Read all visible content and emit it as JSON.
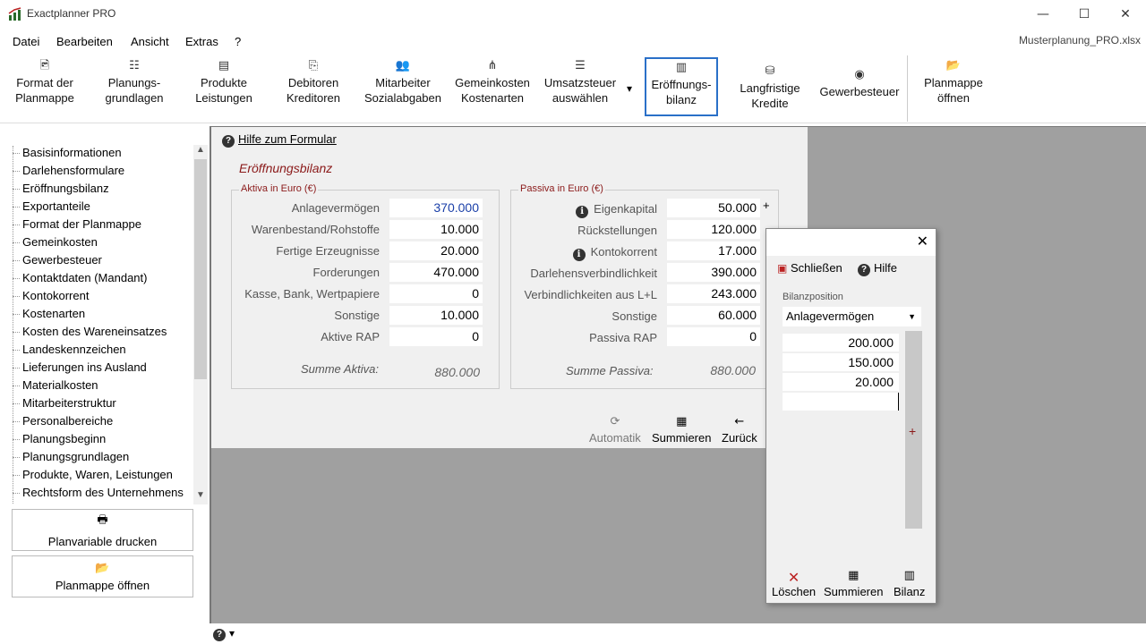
{
  "window": {
    "title": "Exactplanner PRO",
    "filename": "Musterplanung_PRO.xlsx",
    "minimize": "—",
    "maximize": "☐",
    "close": "✕"
  },
  "menu": {
    "items": [
      "Datei",
      "Bearbeiten",
      "Ansicht",
      "Extras",
      "?"
    ]
  },
  "ribbon": {
    "buttons": [
      {
        "label1": "Format der",
        "label2": "Planmappe",
        "icon": "🖻"
      },
      {
        "label1": "Planungs-",
        "label2": "grundlagen",
        "icon": "☷"
      },
      {
        "label1": "Produkte",
        "label2": "Leistungen",
        "icon": "▤"
      },
      {
        "label1": "Debitoren",
        "label2": "Kreditoren",
        "icon": "⎘"
      },
      {
        "label1": "Mitarbeiter",
        "label2": "Sozialabgaben",
        "icon": "👥"
      },
      {
        "label1": "Gemeinkosten",
        "label2": "Kostenarten",
        "icon": "⋔"
      },
      {
        "label1": "Umsatzsteuer",
        "label2": "auswählen",
        "icon": "☰"
      },
      {
        "label1": "Eröffnungs-",
        "label2": "bilanz",
        "icon": "▥"
      },
      {
        "label1": "Langfristige",
        "label2": "Kredite",
        "icon": "⛁"
      },
      {
        "label1": "Gewerbesteuer",
        "label2": "",
        "icon": "◉"
      },
      {
        "label1": "Planmappe",
        "label2": "öffnen",
        "icon": "📂"
      }
    ],
    "dropdown_icon": "▾"
  },
  "sidebar": {
    "items": [
      "Basisinformationen",
      "Darlehensformulare",
      "Eröffnungsbilanz",
      "Exportanteile",
      "Format der Planmappe",
      "Gemeinkosten",
      "Gewerbesteuer",
      "Kontaktdaten (Mandant)",
      "Kontokorrent",
      "Kostenarten",
      "Kosten des Wareneinsatzes",
      "Landeskennzeichen",
      "Lieferungen ins Ausland",
      "Materialkosten",
      "Mitarbeiterstruktur",
      "Personalbereiche",
      "Planungsbeginn",
      "Planungsgrundlagen",
      "Produkte, Waren, Leistungen",
      "Rechtsform des Unternehmens"
    ],
    "print_button": "Planvariable drucken",
    "open_button": "Planmappe öffnen",
    "print_icon": "🖶",
    "open_icon": "📂"
  },
  "form": {
    "help": "Hilfe zum Formular",
    "title": "Eröffnungsbilanz",
    "aktiva": {
      "legend": "Aktiva  in Euro (€)",
      "rows": [
        {
          "label": "Anlagevermögen",
          "value": "370.000"
        },
        {
          "label": "Warenbestand/Rohstoffe",
          "value": "10.000"
        },
        {
          "label": "Fertige Erzeugnisse",
          "value": "20.000"
        },
        {
          "label": "Forderungen",
          "value": "470.000"
        },
        {
          "label": "Kasse, Bank, Wertpapiere",
          "value": "0"
        },
        {
          "label": "Sonstige",
          "value": "10.000"
        },
        {
          "label": "Aktive RAP",
          "value": "0"
        }
      ],
      "sum_label": "Summe Aktiva:",
      "sum_value": "880.000"
    },
    "passiva": {
      "legend": "Passiva  in Euro (€)",
      "rows": [
        {
          "label": "Eigenkapital",
          "value": "50.000"
        },
        {
          "label": "Rückstellungen",
          "value": "120.000"
        },
        {
          "label": "Kontokorrent",
          "value": "17.000"
        },
        {
          "label": "Darlehensverbindlichkeit",
          "value": "390.000"
        },
        {
          "label": "Verbindlichkeiten aus L+L",
          "value": "243.000"
        },
        {
          "label": "Sonstige",
          "value": "60.000"
        },
        {
          "label": "Passiva RAP",
          "value": "0"
        }
      ],
      "sum_label": "Summe Passiva:",
      "sum_value": "880.000",
      "plus": "+"
    },
    "buttons": {
      "automatik": "Automatik",
      "summieren": "Summieren",
      "zurueck": "Zurück"
    }
  },
  "popup": {
    "close": "✕",
    "schliessen": "Schließen",
    "hilfe": "Hilfe",
    "field_label": "Bilanzposition",
    "selected": "Anlagevermögen",
    "values": [
      "200.000",
      "150.000",
      "20.000",
      ""
    ],
    "plus": "+",
    "buttons": {
      "loeschen": "Löschen",
      "summieren": "Summieren",
      "bilanz": "Bilanz"
    }
  }
}
